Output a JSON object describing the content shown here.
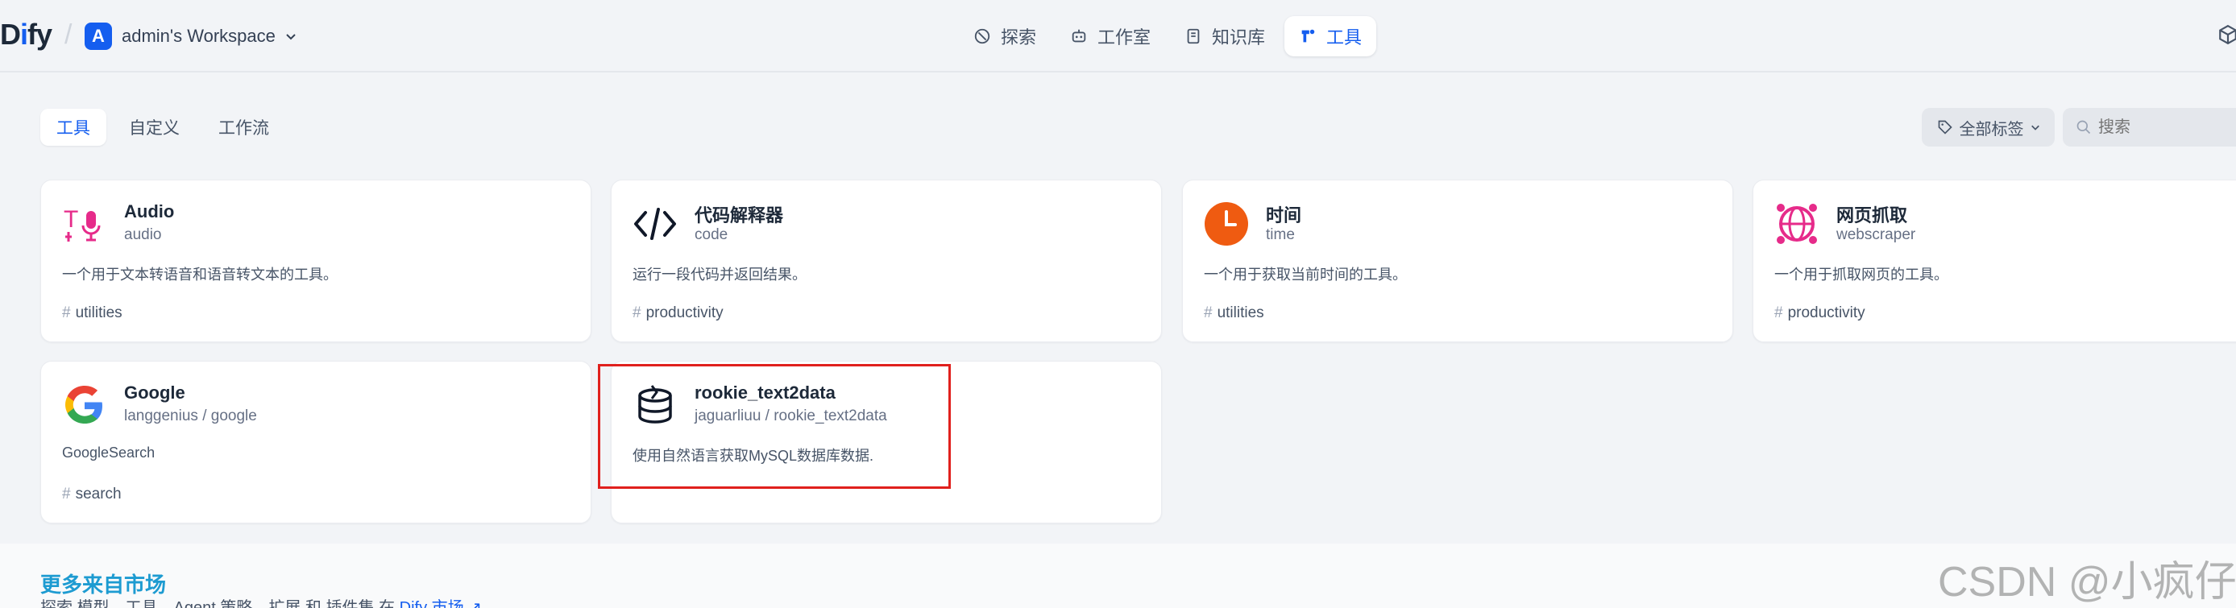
{
  "header": {
    "logo_prefix": "D",
    "logo_i": "i",
    "logo_suffix": "fy",
    "slash": "/",
    "workspace": {
      "avatar": "A",
      "name": "admin's Workspace"
    },
    "nav": [
      {
        "label": "探索",
        "icon": "explore-icon"
      },
      {
        "label": "工作室",
        "icon": "robot-icon"
      },
      {
        "label": "知识库",
        "icon": "book-icon"
      },
      {
        "label": "工具",
        "icon": "tool-icon",
        "active": true
      }
    ]
  },
  "tabs": [
    {
      "label": "工具",
      "active": true
    },
    {
      "label": "自定义"
    },
    {
      "label": "工作流"
    }
  ],
  "filter": {
    "tag_label": "全部标签",
    "search_placeholder": "搜索"
  },
  "tools": [
    {
      "name": "Audio",
      "sub": "audio",
      "desc": "一个用于文本转语音和语音转文本的工具。",
      "tag": "utilities",
      "icon": "audio-icon"
    },
    {
      "name": "代码解释器",
      "sub": "code",
      "desc": "运行一段代码并返回结果。",
      "tag": "productivity",
      "icon": "code-icon"
    },
    {
      "name": "时间",
      "sub": "time",
      "desc": "一个用于获取当前时间的工具。",
      "tag": "utilities",
      "icon": "clock-icon"
    },
    {
      "name": "网页抓取",
      "sub": "webscraper",
      "desc": "一个用于抓取网页的工具。",
      "tag": "productivity",
      "icon": "globe-icon"
    },
    {
      "name": "Google",
      "sub": "langgenius / google",
      "desc": "GoogleSearch",
      "tag": "search",
      "icon": "google-icon"
    },
    {
      "name": "rookie_text2data",
      "sub": "jaguarliuu / rookie_text2data",
      "desc": "使用自然语言获取MySQL数据库数据.",
      "tag": "",
      "icon": "database-icon"
    }
  ],
  "marketplace": {
    "title": "更多来自市场",
    "text": "探索 模型、工具、Agent 策略、扩展 和 插件集 在",
    "link": "Dify 市场 ↗"
  },
  "watermark": "CSDN @小疯仔",
  "colors": {
    "accent": "#155eef",
    "highlight": "#e0201d",
    "pink": "#e62b8a",
    "orange": "#ef5b11"
  }
}
